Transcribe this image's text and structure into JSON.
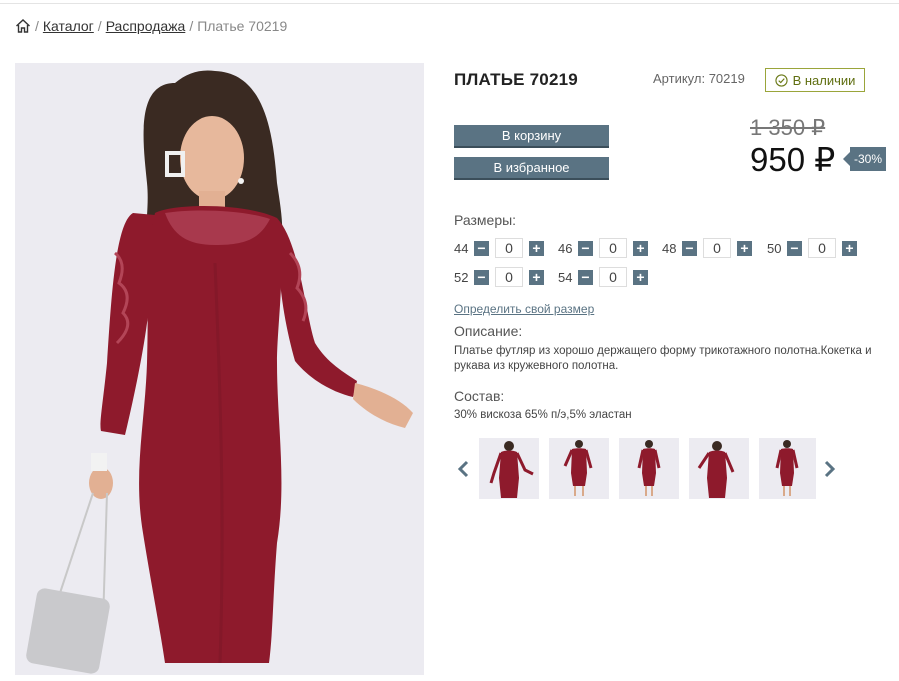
{
  "breadcrumb": {
    "home_icon": "home-icon",
    "separator": "/",
    "items": [
      "Каталог",
      "Распродажа"
    ],
    "current": "Платье 70219"
  },
  "product": {
    "title": "ПЛАТЬЕ 70219",
    "sku": "Артикул: 70219",
    "stock": "В наличии",
    "stock_icon": "check-circle-icon",
    "add_to_cart": "В корзину",
    "add_to_favorites": "В избранное",
    "old_price": "1 350 ₽",
    "price": "950 ₽",
    "discount": "-30%",
    "sizes_label": "Размеры:",
    "sizes": [
      {
        "size": "44",
        "qty": "0"
      },
      {
        "size": "46",
        "qty": "0"
      },
      {
        "size": "48",
        "qty": "0"
      },
      {
        "size": "50",
        "qty": "0"
      },
      {
        "size": "52",
        "qty": "0"
      },
      {
        "size": "54",
        "qty": "0"
      }
    ],
    "minus": "−",
    "plus": "+",
    "size_link": "Определить свой размер",
    "description_label": "Описание:",
    "description": "Платье футляр из хорошо держащего форму трикотажного полотна.Кокетка и рукава из кружевного полотна.",
    "composition_label": "Состав:",
    "composition": "30% вискоза 65% п/э,5% эластан"
  },
  "gallery": {
    "prev_icon": "chevron-left-icon",
    "next_icon": "chevron-right-icon",
    "thumbnail_count": 5
  },
  "colors": {
    "accent": "#5a7383",
    "dress": "#8e1a2c",
    "photo_bg": "#ecebf1",
    "stock_border": "#9aa53a"
  }
}
